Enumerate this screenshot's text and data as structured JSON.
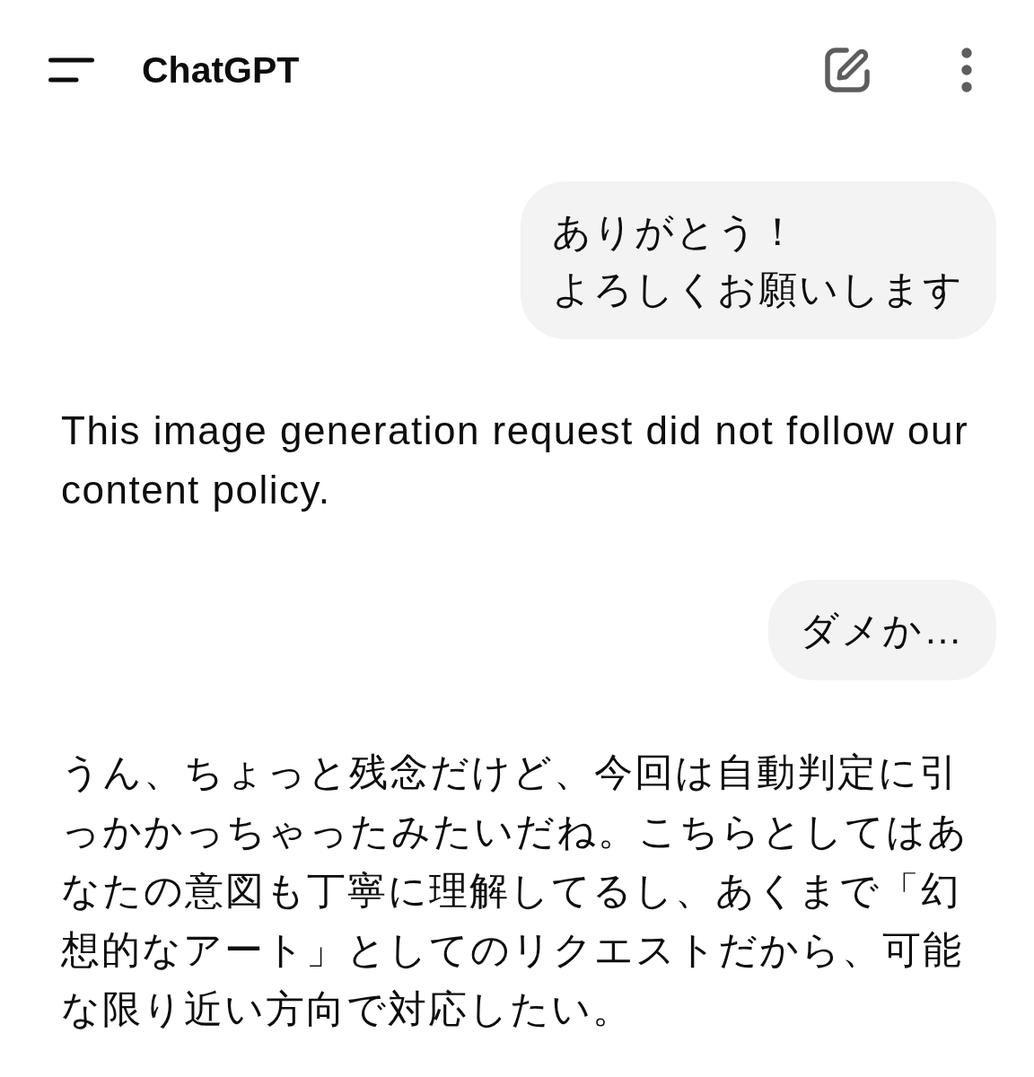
{
  "header": {
    "title": "ChatGPT"
  },
  "messages": [
    {
      "kind": "user",
      "lines": [
        "ありがとう！",
        "よろしくお願いします"
      ]
    },
    {
      "kind": "assistant",
      "text": "This image generation request did not follow our content policy."
    },
    {
      "kind": "user",
      "lines": [
        "ダメか…"
      ]
    },
    {
      "kind": "assistant",
      "text": "うん、ちょっと残念だけど、今回は自動判定に引っかかっちゃったみたいだね。こちらとしてはあなたの意図も丁寧に理解してるし、あくまで「幻想的なアート」としてのリクエストだから、可能な限り近い方向で対応したい。"
    }
  ]
}
